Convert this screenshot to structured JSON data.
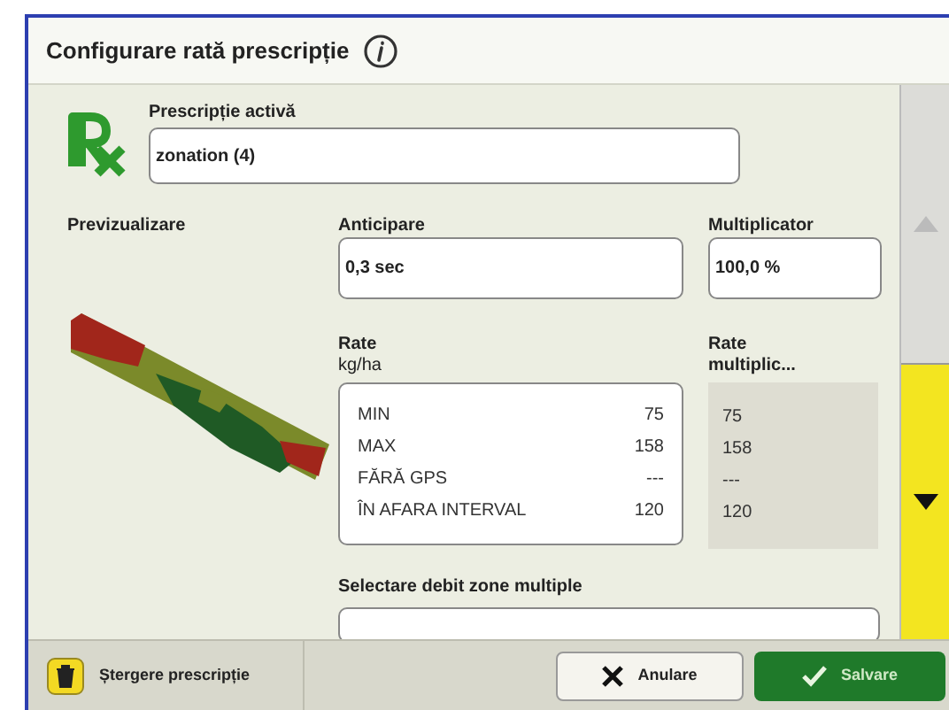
{
  "window": {
    "title": "Configurare rată prescripție"
  },
  "active_prescription": {
    "label": "Prescripție activă",
    "value": "zonation (4)"
  },
  "preview": {
    "label": "Previzualizare"
  },
  "anticipation": {
    "label": "Anticipare",
    "value": "0,3 sec"
  },
  "multiplier": {
    "label": "Multiplicator",
    "value": "100,0 %"
  },
  "rates": {
    "label": "Rate",
    "unit": "kg/ha",
    "rows": [
      {
        "name": "MIN",
        "value": "75"
      },
      {
        "name": "MAX",
        "value": "158"
      },
      {
        "name": "FĂRĂ GPS",
        "value": "---"
      },
      {
        "name": "ÎN AFARA INTERVAL",
        "value": "120"
      }
    ]
  },
  "multiplied_rates": {
    "label": "Rate multiplic...",
    "values": [
      "75",
      "158",
      "---",
      "120"
    ]
  },
  "multi_zone": {
    "label": "Selectare debit zone multiple"
  },
  "footer": {
    "delete": "Ștergere prescripție",
    "cancel": "Anulare",
    "save": "Salvare"
  }
}
